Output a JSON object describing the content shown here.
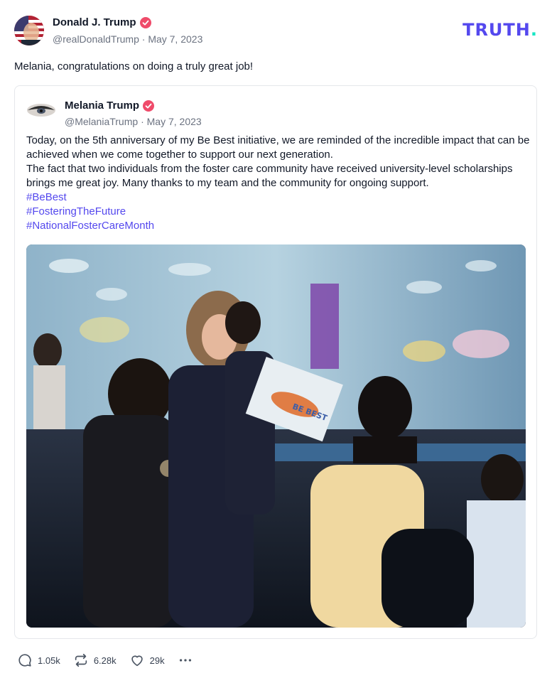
{
  "brand": {
    "logo_main": "TRUTH",
    "logo_dot": ".",
    "accent": "#5448ee",
    "dot_color": "#17e6c4"
  },
  "post": {
    "author_name": "Donald J. Trump",
    "author_handle": "@realDonaldTrump",
    "separator": "·",
    "date": "May 7, 2023",
    "text": "Melania, congratulations on doing a truly great job!",
    "avatar_icon": "flag-avatar-icon",
    "verified_icon": "verified-badge-icon"
  },
  "quote": {
    "author_name": "Melania Trump",
    "author_handle": "@MelaniaTrump",
    "separator": "·",
    "date": "May 7, 2023",
    "paragraph_1": "Today, on the 5th anniversary of my Be Best initiative, we are reminded of the incredible impact that can be achieved when we come together to support our next generation.",
    "paragraph_2": "The fact that two individuals from the foster care community have received university-level scholarships brings me great joy. Many thanks to my team and the community for ongoing support.",
    "hashtags": [
      "#BeBest",
      "#FosteringTheFuture",
      "#NationalFosterCareMonth"
    ],
    "photo_sign_text": "BE BEST"
  },
  "actions": {
    "replies": "1.05k",
    "retruths": "6.28k",
    "likes": "29k",
    "more_icon": "more-options-icon"
  }
}
